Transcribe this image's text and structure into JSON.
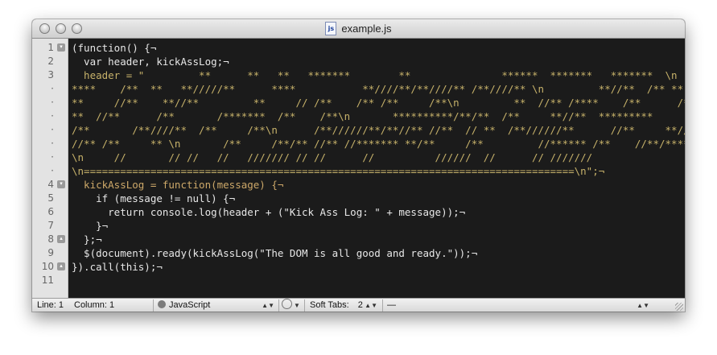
{
  "window": {
    "title": "example.js",
    "file_icon_text": "js"
  },
  "gutter": {
    "line_numbers": [
      "1",
      "2",
      "3",
      "·",
      "·",
      "·",
      "·",
      "·",
      "·",
      "·",
      "4",
      "5",
      "6",
      "7",
      "8",
      "9",
      "10",
      "11"
    ],
    "fold_markers": [
      "▾",
      "",
      "",
      "",
      "",
      "",
      "",
      "",
      "",
      "",
      "▾",
      "",
      "",
      "",
      "▴",
      "",
      "▴",
      ""
    ]
  },
  "code": {
    "lines": [
      "(function() {¬",
      "  var header, kickAssLog;¬",
      "  header = \"         **      **   **   *******        **               ******  *******   *******  \\n",
      "****    /**  **   **/////**      ****           **////**/**////** /**////** \\n         **//**  /** **",
      "**     //**    **//**         **     // /**    /** /**     /**\\n         **  //** /****    /**      /**",
      "**  //**      /**       /*******  /**    /**\\n       **********/**/**  /**     **//**  *********",
      "/**       /**////**  /**     /**\\n      /**//////**/**//** //**  // **  /**//////**      //**     **//**",
      "//** /**     ** \\n       /**     /**/** //** //******* **/**     /**         //****** /**    //**/*******",
      "\\n     //       // //   //   /////// // //      //          //////  //      // ///////",
      "\\n=================================================================================\\n\";¬",
      "  kickAssLog = function(message) {¬",
      "    if (message != null) {¬",
      "      return console.log(header + (\"Kick Ass Log: \" + message));¬",
      "    }¬",
      "  };¬",
      "  $(document).ready(kickAssLog(\"The DOM is all good and ready.\"));¬",
      "}).call(this);¬",
      ""
    ]
  },
  "statusbar": {
    "line": "Line: 1",
    "column": "Column: 1",
    "language": "JavaScript",
    "soft_tabs_label": "Soft Tabs:",
    "soft_tabs_value": "2",
    "symbol": "—"
  },
  "colors": {
    "background": "#1b1b1b",
    "keyword": "#cda869",
    "string": "#8f9d6a",
    "support": "#9b703f",
    "gutter": "#e3e3e3"
  }
}
